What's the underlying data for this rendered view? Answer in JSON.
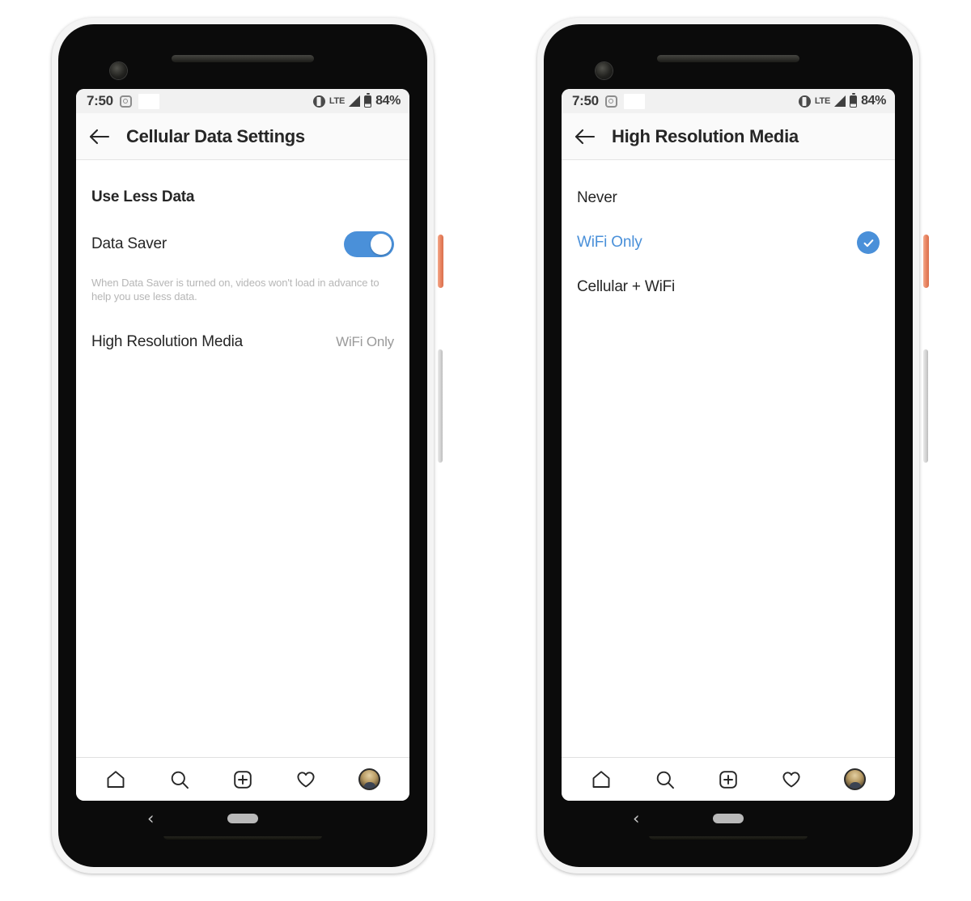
{
  "screens": [
    {
      "id": "cellular-data-settings",
      "status_bar": {
        "time": "7:50",
        "notif_icon": "instagram-camera-icon",
        "vibrate_icon": "vibrate-icon",
        "network": "LTE",
        "signal_icon": "signal-bars-icon",
        "battery_icon": "battery-icon",
        "battery": "84%"
      },
      "header": {
        "back_icon": "back-arrow-icon",
        "title": "Cellular Data Settings"
      },
      "section_title": "Use Less Data",
      "data_saver": {
        "label": "Data Saver",
        "toggle_state": "on",
        "helper": "When Data Saver is turned on, videos won't load in advance to help you use less data."
      },
      "high_res": {
        "label": "High Resolution Media",
        "value": "WiFi Only"
      }
    },
    {
      "id": "high-resolution-media",
      "status_bar": {
        "time": "7:50",
        "notif_icon": "instagram-camera-icon",
        "vibrate_icon": "vibrate-icon",
        "network": "LTE",
        "signal_icon": "signal-bars-icon",
        "battery_icon": "battery-icon",
        "battery": "84%"
      },
      "header": {
        "back_icon": "back-arrow-icon",
        "title": "High Resolution Media"
      },
      "options": [
        {
          "label": "Never",
          "selected": false
        },
        {
          "label": "WiFi Only",
          "selected": true
        },
        {
          "label": "Cellular + WiFi",
          "selected": false
        }
      ]
    }
  ],
  "app_nav": {
    "items": [
      "home-icon",
      "search-icon",
      "add-post-icon",
      "activity-heart-icon",
      "profile-avatar"
    ]
  },
  "system_nav": {
    "back": "‹",
    "home_pill": "home-pill"
  },
  "colors": {
    "accent_blue": "#4a90d9",
    "text_primary": "#262626",
    "text_muted": "#9a9a9a",
    "helper_text": "#b6b6b6",
    "power_button": "#e8825f",
    "frame": "#f4f4f4",
    "bezel": "#0b0b0b"
  }
}
